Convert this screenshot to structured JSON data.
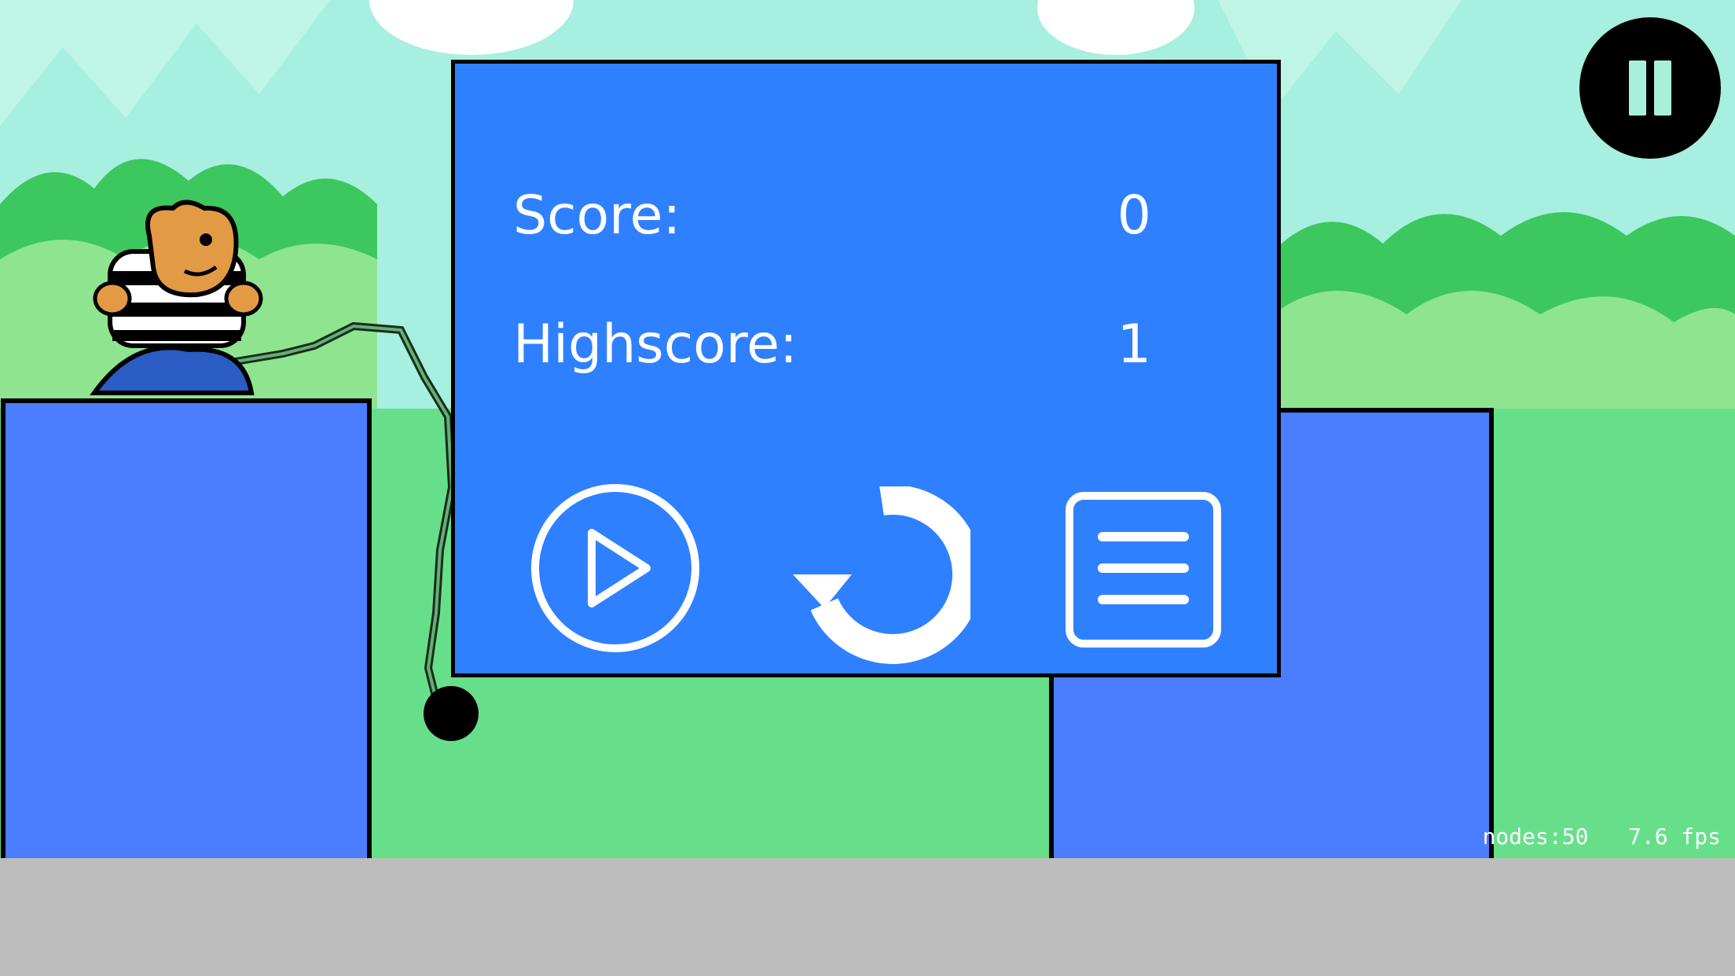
{
  "hud": {
    "pause_icon": "pause-icon"
  },
  "game_over_panel": {
    "score_label": "Score:",
    "score_value": "0",
    "highscore_label": "Highscore:",
    "highscore_value": "1",
    "buttons": [
      {
        "name": "resume-button",
        "icon": "play-icon"
      },
      {
        "name": "restart-button",
        "icon": "restart-icon"
      },
      {
        "name": "menu-button",
        "icon": "menu-icon"
      }
    ]
  },
  "debug": {
    "stats": "nodes:50   7.6 fps"
  },
  "colors": {
    "sky": "#a7efdf",
    "panel": "#2f80ff",
    "pillar": "#4a7dff",
    "grass": "#67df8a",
    "ground": "#bdbdbd",
    "bush_dark": "#3cc75f",
    "bush_light": "#8fe58f"
  }
}
